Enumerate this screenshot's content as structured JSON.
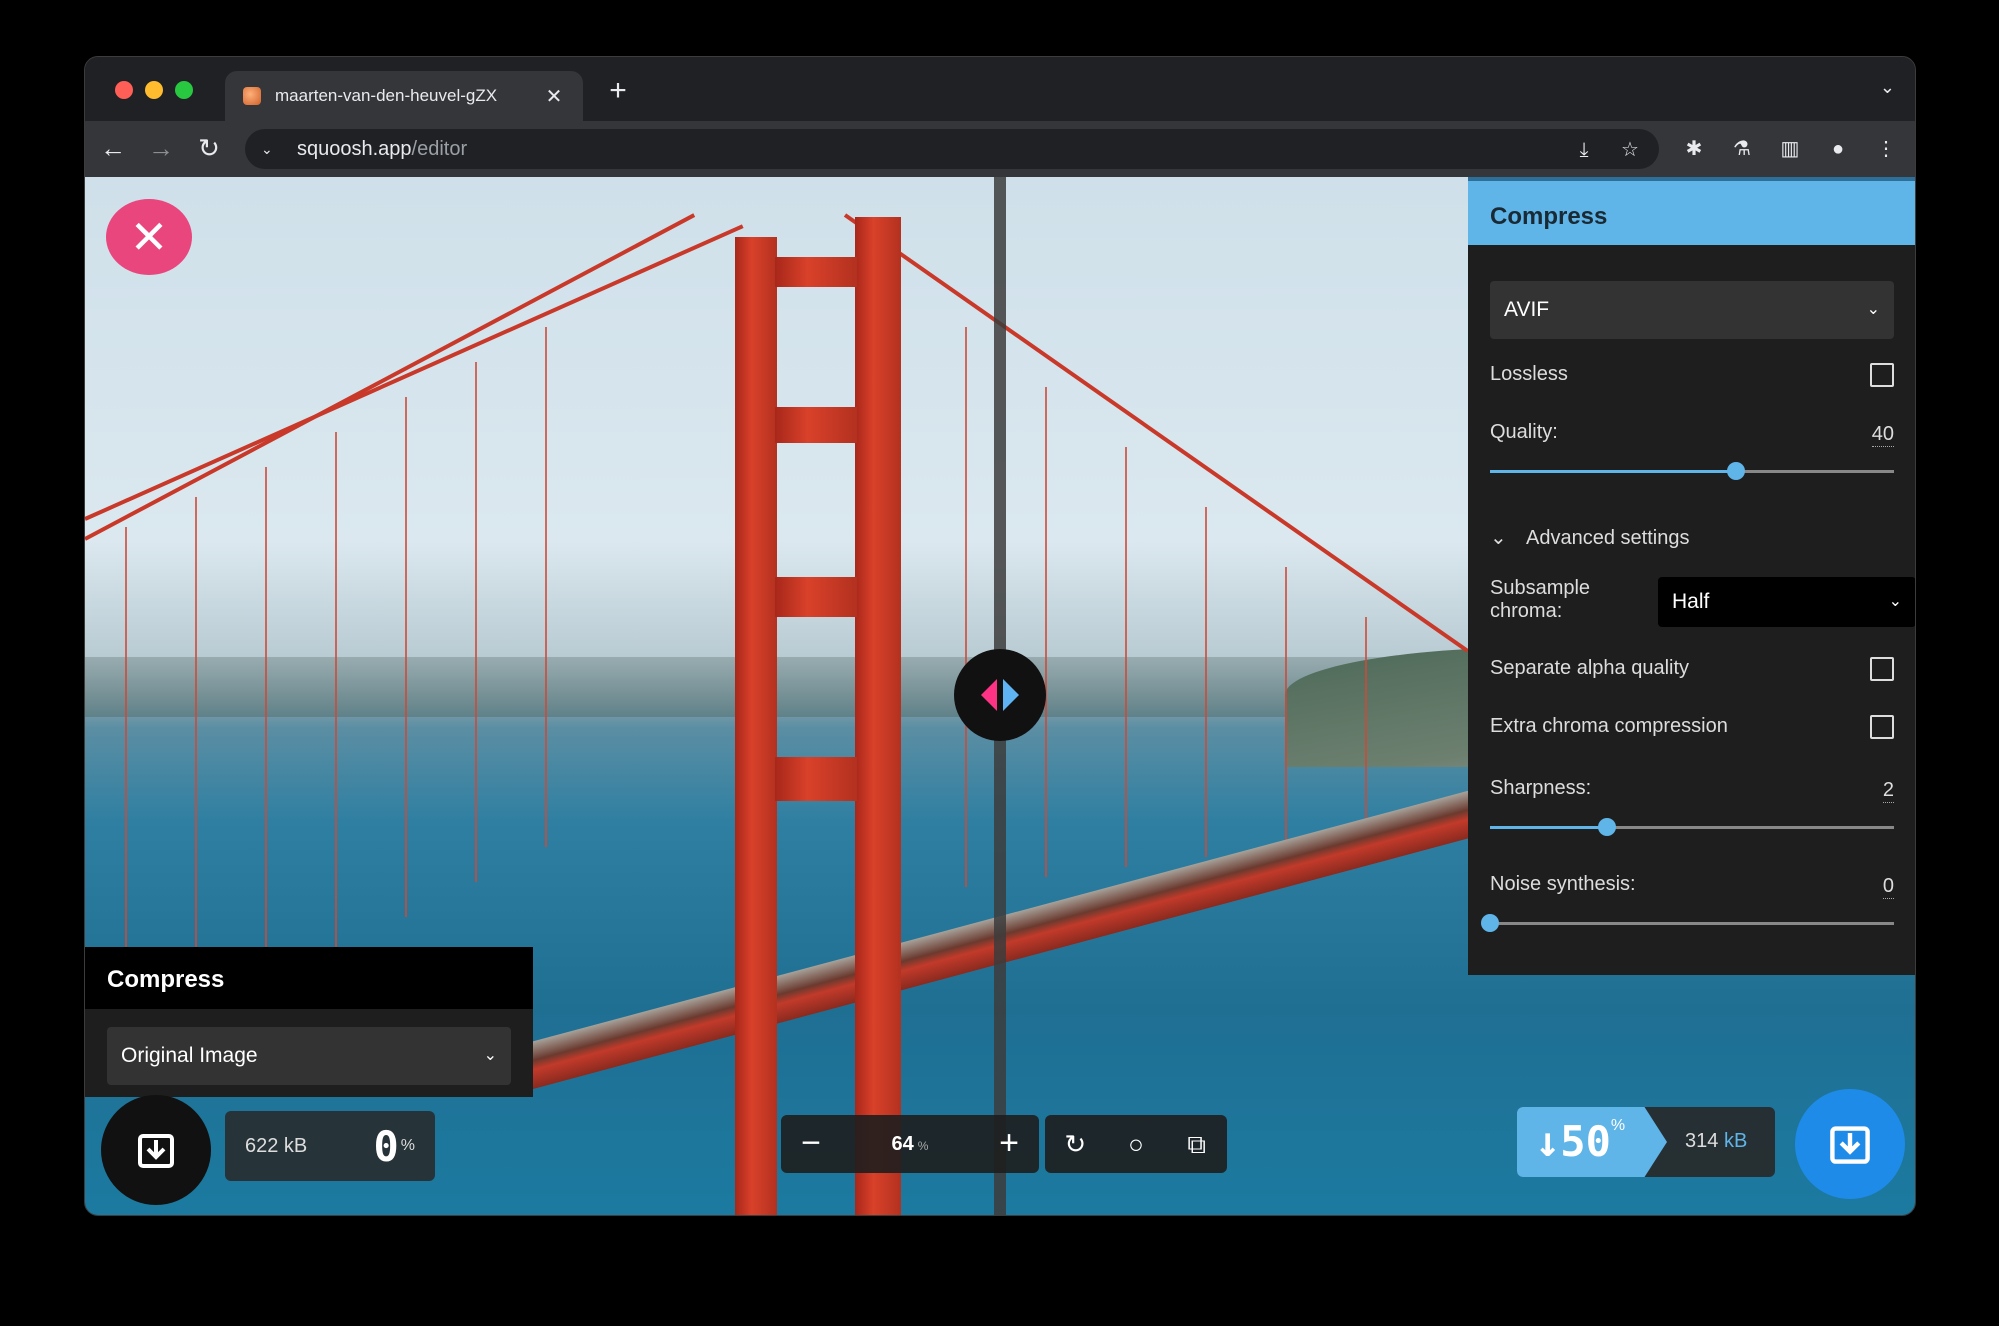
{
  "browser": {
    "tab_title": "maarten-van-den-heuvel-gZX",
    "url_host": "squoosh.app",
    "url_path": "/editor"
  },
  "left_panel": {
    "title": "Compress",
    "select_value": "Original Image",
    "size": "622 kB",
    "percent": "0",
    "percent_unit": "%"
  },
  "zoom": {
    "value": "64",
    "unit": "%"
  },
  "right_panel": {
    "title": "Compress",
    "format": "AVIF",
    "lossless_label": "Lossless",
    "lossless_checked": false,
    "quality_label": "Quality:",
    "quality_value": "40",
    "quality_level": 0.61,
    "advanced_label": "Advanced settings",
    "subsample_label_1": "Subsample",
    "subsample_label_2": "chroma:",
    "subsample_value": "Half",
    "separate_alpha_label": "Separate alpha quality",
    "extra_chroma_label": "Extra chroma compression",
    "sharpness_label": "Sharpness:",
    "sharpness_value": "2",
    "sharpness_level": 0.29,
    "noise_label": "Noise synthesis:",
    "noise_value": "0",
    "noise_level": 0.0,
    "size": "314",
    "size_unit": "kB",
    "percent": "↓50",
    "percent_unit": "%"
  },
  "colors": {
    "accent_blue": "#5fb4e8",
    "accent_pink": "#e8467c",
    "download_blue": "#1f8be8"
  }
}
